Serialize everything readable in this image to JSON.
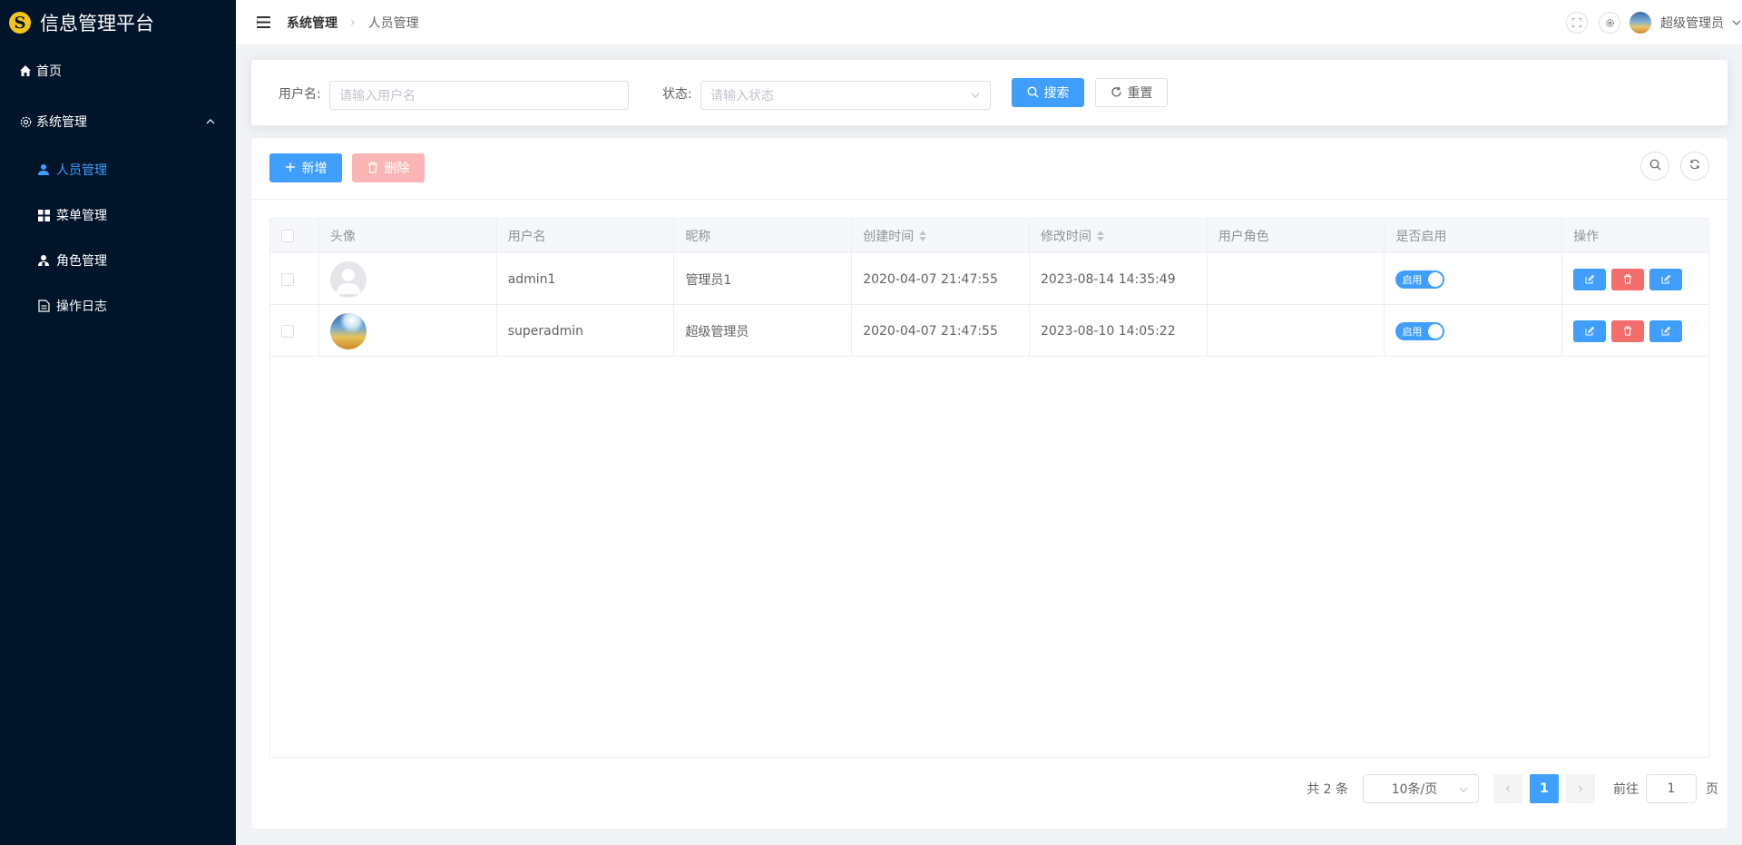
{
  "app": {
    "title": "信息管理平台",
    "logo_letter": "S"
  },
  "sidebar": {
    "home": "首页",
    "system": "系统管理",
    "items": [
      {
        "label": "人员管理",
        "icon": "user-icon",
        "active": true
      },
      {
        "label": "菜单管理",
        "icon": "grid-icon",
        "active": false
      },
      {
        "label": "角色管理",
        "icon": "role-icon",
        "active": false
      },
      {
        "label": "操作日志",
        "icon": "document-icon",
        "active": false
      }
    ]
  },
  "header": {
    "breadcrumb": [
      "系统管理",
      "人员管理"
    ],
    "user_name": "超级管理员"
  },
  "search": {
    "username_label": "用户名:",
    "username_placeholder": "请输入用户名",
    "status_label": "状态:",
    "status_placeholder": "请输入状态",
    "search_btn": "搜索",
    "reset_btn": "重置"
  },
  "toolbar": {
    "add_btn": "新增",
    "delete_btn": "删除"
  },
  "table": {
    "columns": [
      "头像",
      "用户名",
      "昵称",
      "创建时间",
      "修改时间",
      "用户角色",
      "是否启用",
      "操作"
    ],
    "rows": [
      {
        "avatar": "default",
        "username": "admin1",
        "nickname": "管理员1",
        "created": "2020-04-07 21:47:55",
        "modified": "2023-08-14 14:35:49",
        "role": "",
        "enabled_label": "启用"
      },
      {
        "avatar": "photo",
        "username": "superadmin",
        "nickname": "超级管理员",
        "created": "2020-04-07 21:47:55",
        "modified": "2023-08-10 14:05:22",
        "role": "",
        "enabled_label": "启用"
      }
    ]
  },
  "pagination": {
    "total": "共 2 条",
    "page_size": "10条/页",
    "current_page": "1",
    "jump_label": "前往",
    "jump_value": "1",
    "unit": "页"
  },
  "colors": {
    "sidebar_bg": "#001529",
    "primary": "#409eff",
    "danger": "#f56c6c",
    "danger_light": "#fab6b6"
  }
}
